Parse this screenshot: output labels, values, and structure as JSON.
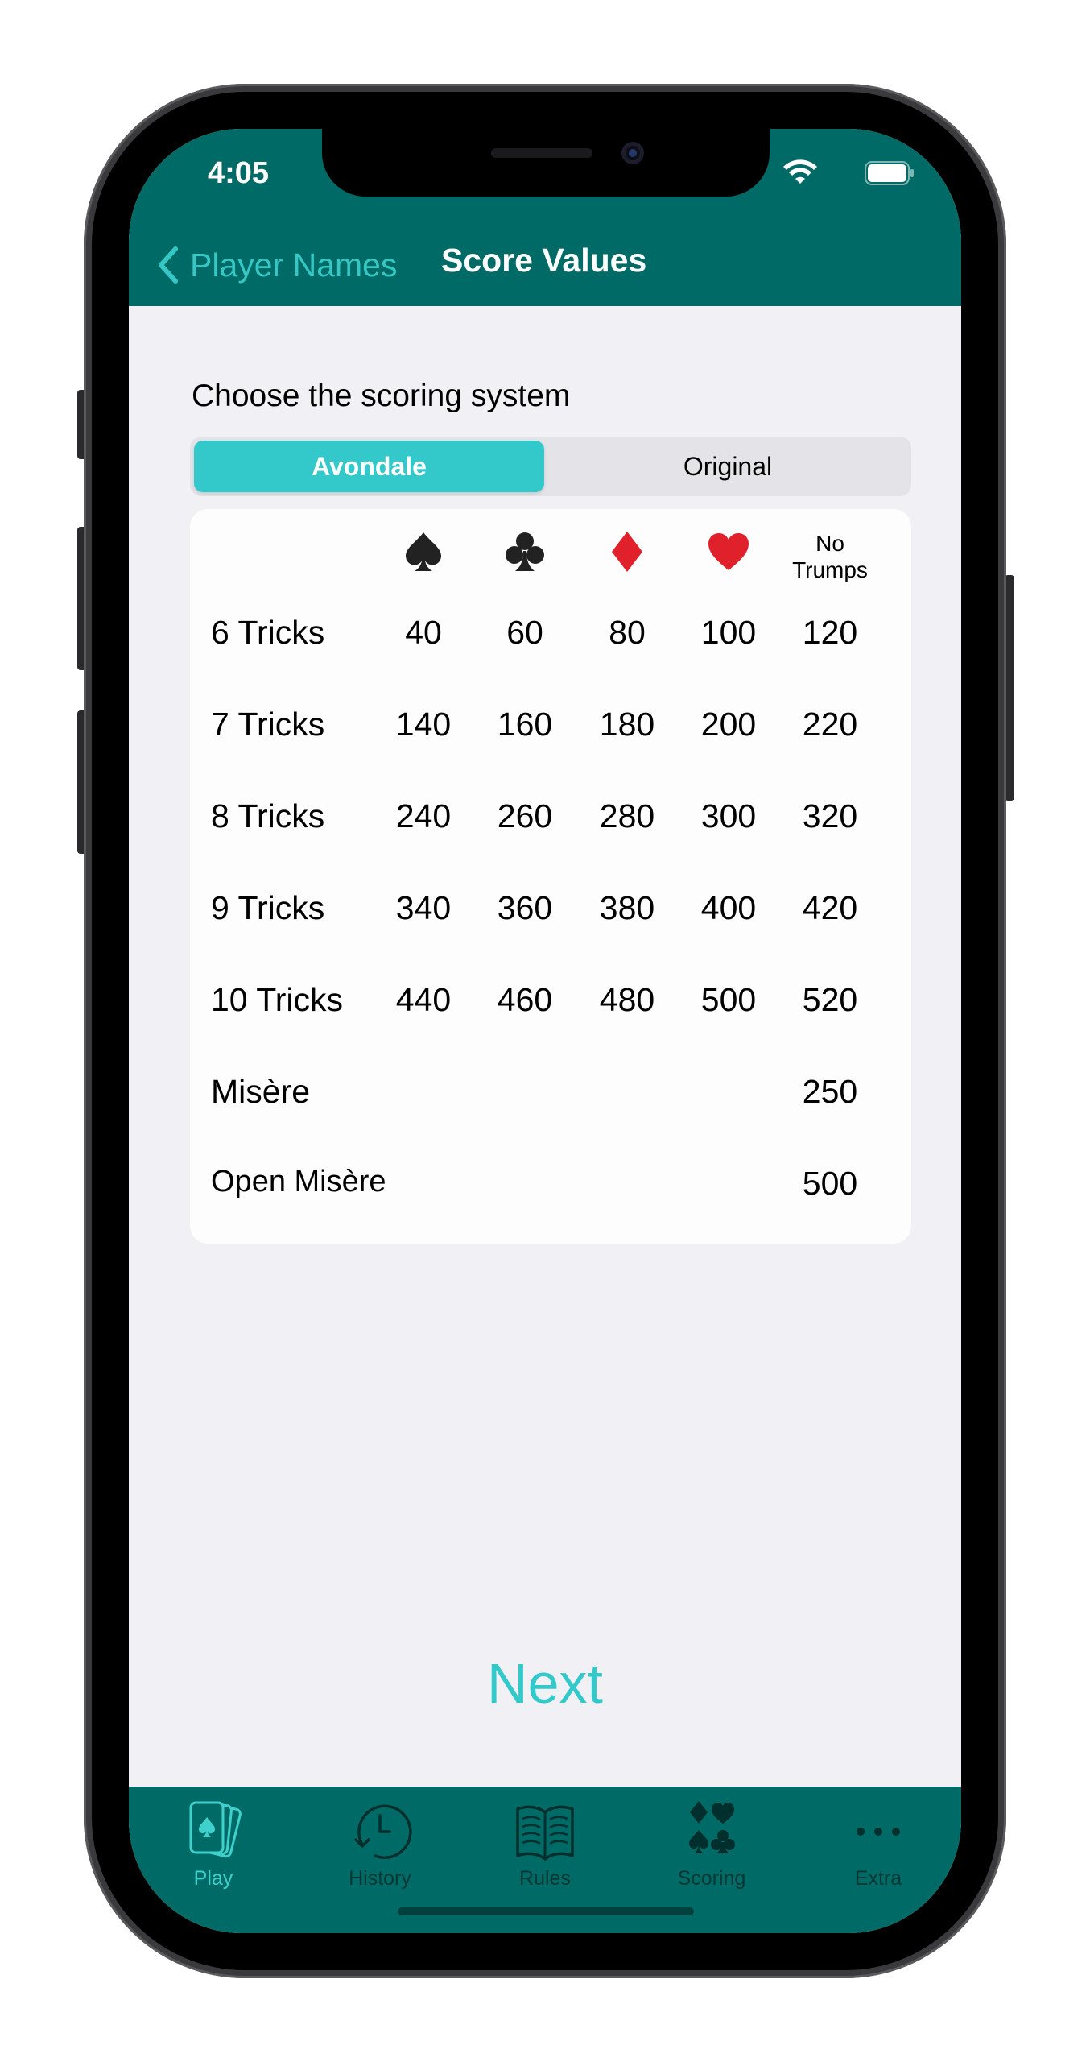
{
  "status_bar": {
    "time": "4:05"
  },
  "nav": {
    "back_label": "Player Names",
    "title": "Score Values"
  },
  "scoring": {
    "prompt": "Choose the scoring system",
    "options": [
      "Avondale",
      "Original"
    ],
    "selected": "Avondale"
  },
  "table": {
    "columns": [
      {
        "icon": "spade-icon"
      },
      {
        "icon": "club-icon"
      },
      {
        "icon": "diamond-icon"
      },
      {
        "icon": "heart-icon"
      },
      {
        "label_line1": "No",
        "label_line2": "Trumps"
      }
    ],
    "rows": [
      {
        "label": "6 Tricks",
        "values": [
          "40",
          "60",
          "80",
          "100",
          "120"
        ]
      },
      {
        "label": "7 Tricks",
        "values": [
          "140",
          "160",
          "180",
          "200",
          "220"
        ]
      },
      {
        "label": "8 Tricks",
        "values": [
          "240",
          "260",
          "280",
          "300",
          "320"
        ]
      },
      {
        "label": "9 Tricks",
        "values": [
          "340",
          "360",
          "380",
          "400",
          "420"
        ]
      },
      {
        "label": "10 Tricks",
        "values": [
          "440",
          "460",
          "480",
          "500",
          "520"
        ]
      },
      {
        "label": "Misère",
        "values": [
          "250"
        ]
      },
      {
        "label": "Open Misère",
        "values": [
          "500"
        ]
      }
    ]
  },
  "next_label": "Next",
  "tabs": [
    {
      "label": "Play",
      "icon": "cards-icon",
      "active": true
    },
    {
      "label": "History",
      "icon": "history-icon",
      "active": false
    },
    {
      "label": "Rules",
      "icon": "book-icon",
      "active": false
    },
    {
      "label": "Scoring",
      "icon": "suits-icon",
      "active": false
    },
    {
      "label": "Extra",
      "icon": "more-icon",
      "active": false
    }
  ],
  "colors": {
    "header": "#006b66",
    "accent": "#33c9cb",
    "background": "#f0f0f5",
    "red_suit": "#e0202a"
  }
}
